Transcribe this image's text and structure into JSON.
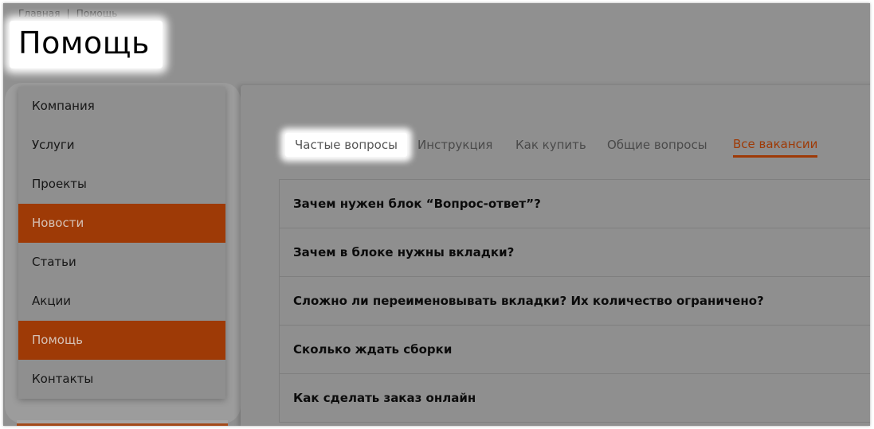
{
  "breadcrumb": {
    "home": "Главная",
    "separator": "|",
    "current": "Помощь"
  },
  "page": {
    "title": "Помощь"
  },
  "sidebar": {
    "items": [
      {
        "label": "Компания",
        "active": false
      },
      {
        "label": "Услуги",
        "active": false
      },
      {
        "label": "Проекты",
        "active": false
      },
      {
        "label": "Новости",
        "active": true
      },
      {
        "label": "Статьи",
        "active": false
      },
      {
        "label": "Акции",
        "active": false
      },
      {
        "label": "Помощь",
        "active": true
      },
      {
        "label": "Контакты",
        "active": false
      }
    ]
  },
  "tabs": {
    "items": [
      {
        "label": "Частые вопросы",
        "state": "highlighted"
      },
      {
        "label": "Инструкция",
        "state": "normal"
      },
      {
        "label": "Как купить",
        "state": "normal"
      },
      {
        "label": "Общие вопросы",
        "state": "normal"
      },
      {
        "label": "Все вакансии",
        "state": "accent"
      }
    ]
  },
  "faq": {
    "items": [
      "Зачем нужен блок “Вопрос-ответ”?",
      "Зачем в блоке нужны вкладки?",
      "Сложно ли переименовывать вкладки? Их количество ограничено?",
      "Сколько ждать сборки",
      "Как сделать заказ онлайн"
    ]
  },
  "colors": {
    "accent": "#9e3a06",
    "overlay": "#909090",
    "highlight": "#ffffff"
  }
}
